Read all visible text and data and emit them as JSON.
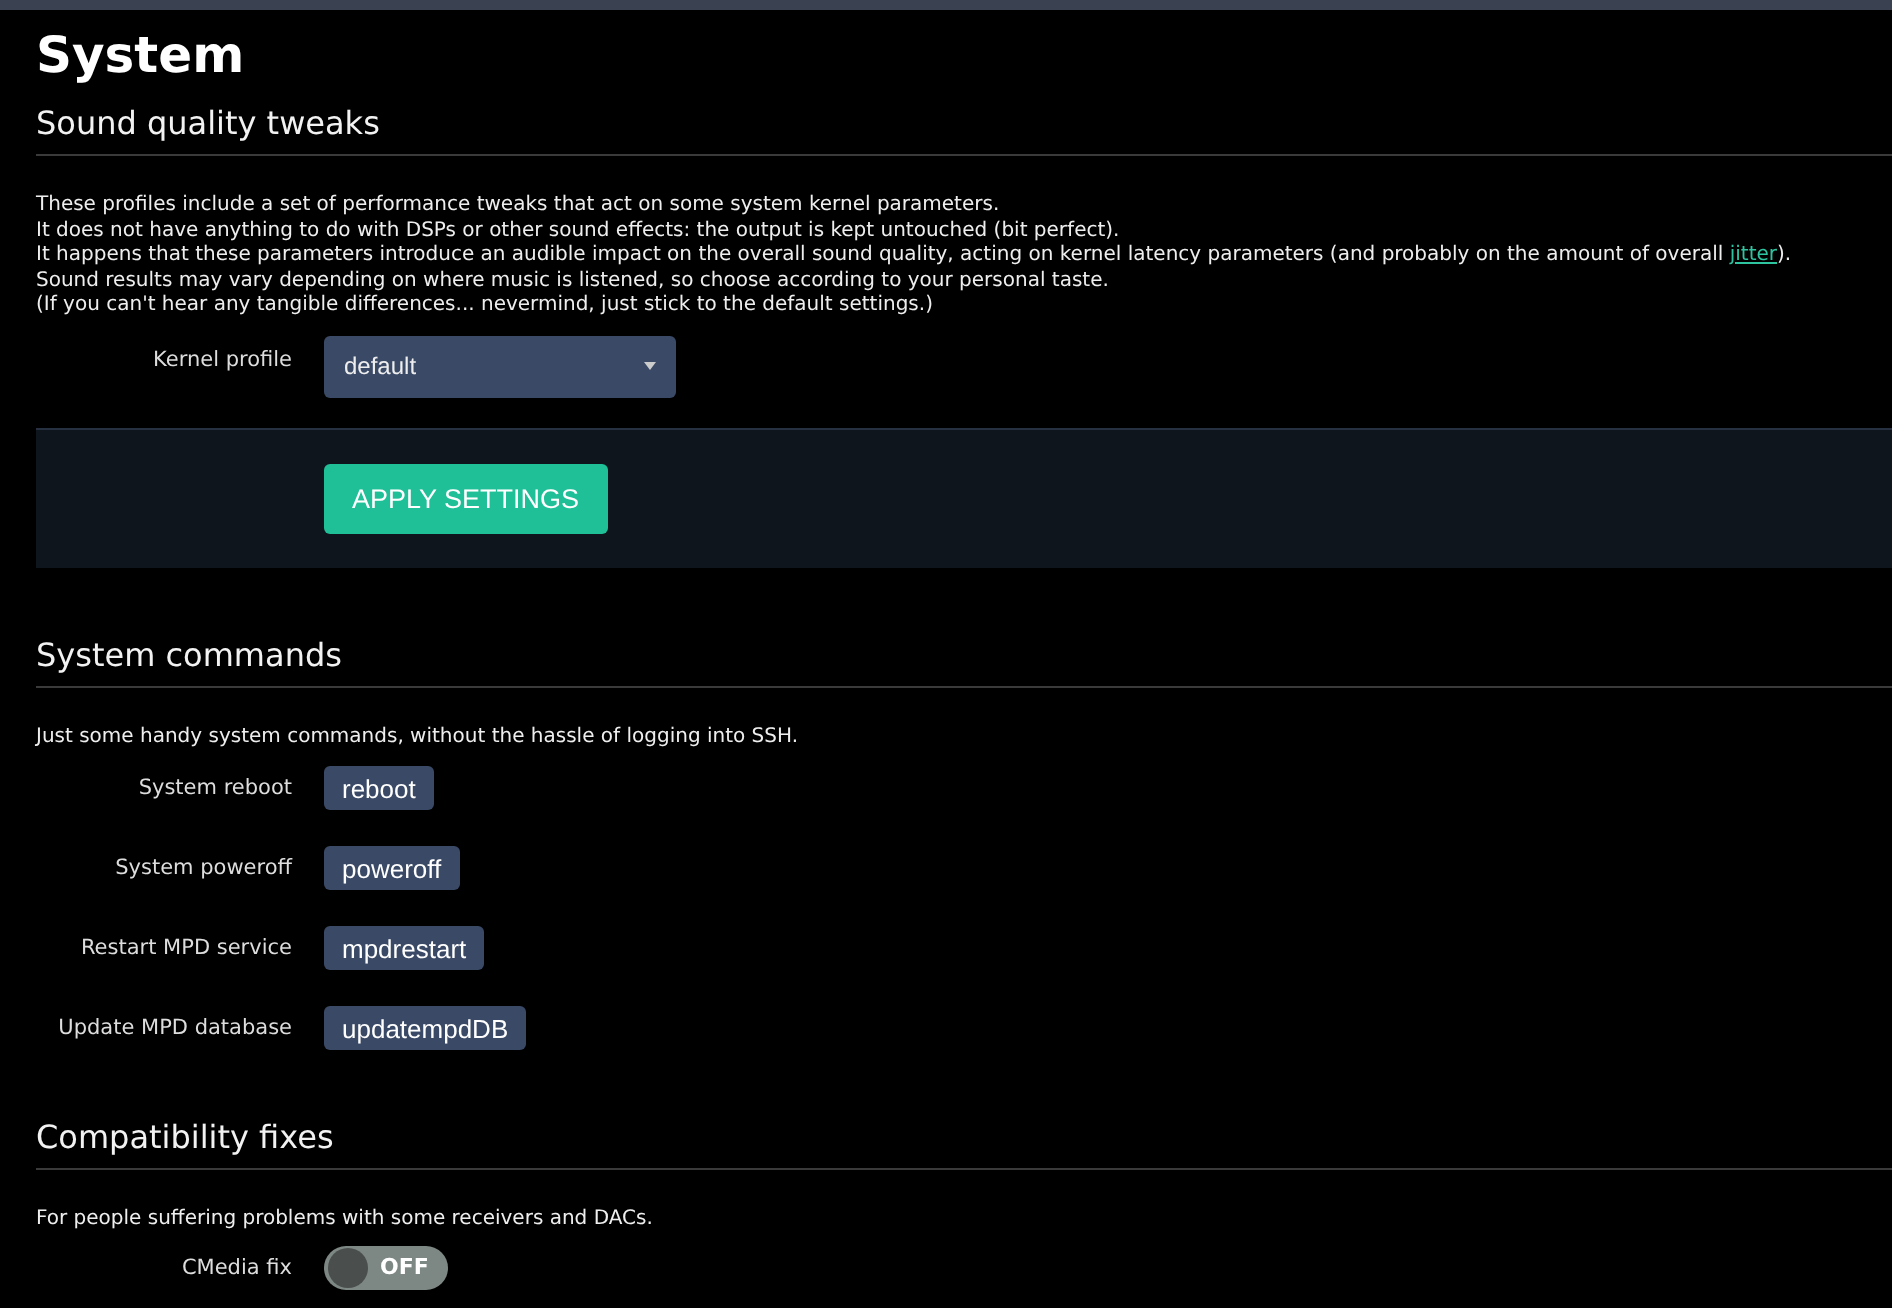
{
  "page_title": "System",
  "sections": [
    {
      "kind": "tweaks",
      "title": "Sound quality tweaks",
      "lines": [
        {
          "text": "These profiles include a set of performance tweaks that act on some system kernel parameters."
        },
        {
          "text": "It does not have anything to do with DSPs or other sound effects: the output is kept untouched (bit perfect)."
        },
        {
          "text": "It happens that these parameters introduce an audible impact on the overall sound quality, acting on kernel latency parameters (and probably on the amount of overall ",
          "link": "jitter",
          "after": ")."
        },
        {
          "text": "Sound results may vary depending on where music is listened, so choose according to your personal taste."
        },
        {
          "text": "(If you can't hear any tangible differences... nevermind, just stick to the default settings.)"
        }
      ],
      "field_label": "Kernel profile",
      "select_value": "default",
      "apply_button": "APPLY SETTINGS"
    },
    {
      "kind": "commands",
      "title": "System commands",
      "lines": [
        {
          "text": "Just some handy system commands, without the hassle of logging into SSH."
        }
      ],
      "rows": [
        {
          "label": "System reboot",
          "button": "reboot"
        },
        {
          "label": "System poweroff",
          "button": "poweroff"
        },
        {
          "label": "Restart MPD service",
          "button": "mpdrestart"
        },
        {
          "label": "Update MPD database",
          "button": "updatempdDB"
        }
      ]
    },
    {
      "kind": "fixes",
      "title": "Compatibility fixes",
      "lines": [
        {
          "text": "For people suffering problems with some receivers and DACs."
        }
      ],
      "toggles": [
        {
          "label": "CMedia fix",
          "state_text": "OFF",
          "on": false
        }
      ]
    }
  ]
}
